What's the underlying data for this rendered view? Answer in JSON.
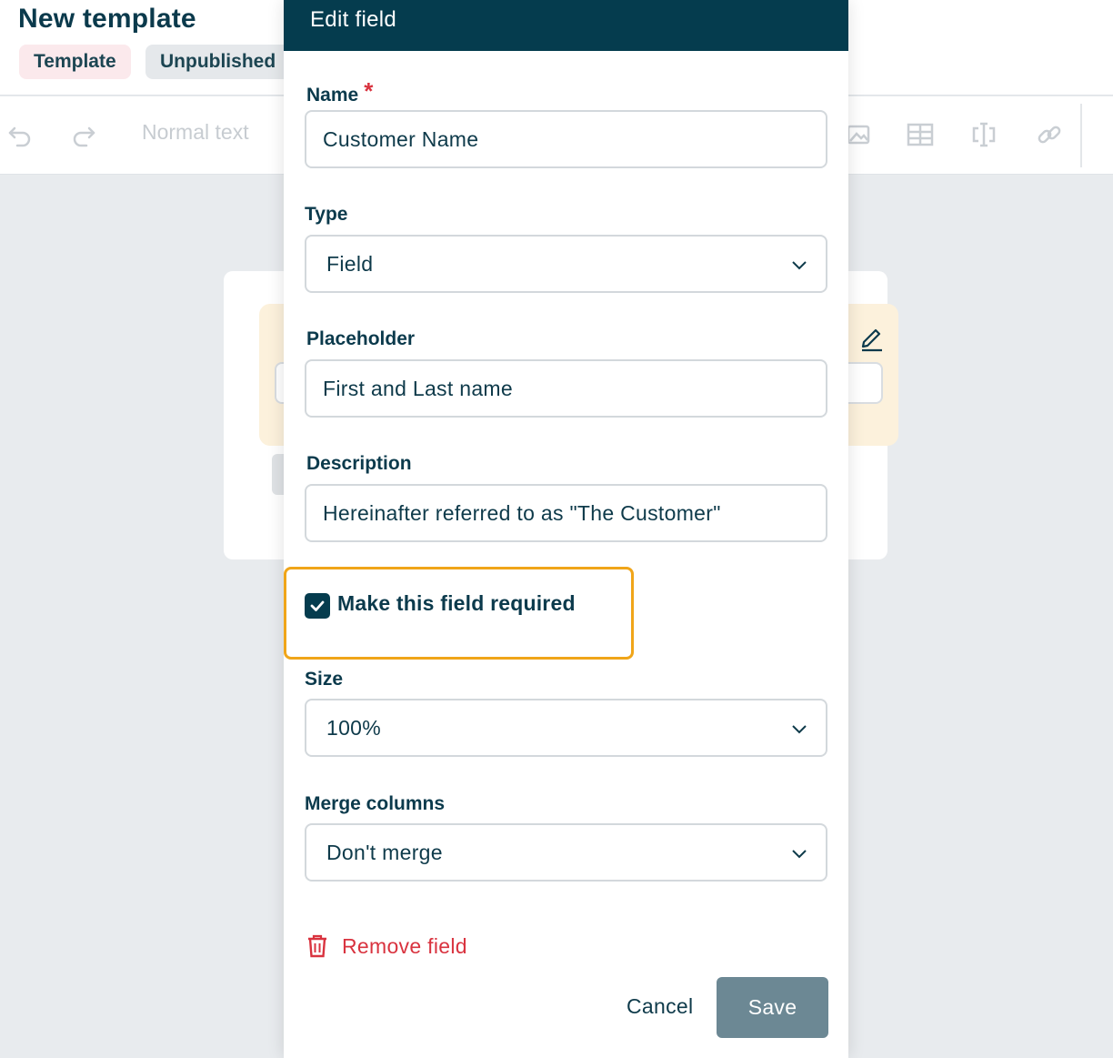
{
  "header": {
    "title": "New template",
    "badges": [
      "Template",
      "Unpublished"
    ]
  },
  "toolbar": {
    "icons": [
      "undo-icon",
      "redo-icon",
      "image-icon",
      "table-icon",
      "field-icon",
      "link-icon"
    ],
    "text_style": "Normal text"
  },
  "modal": {
    "title": "Edit field",
    "name": {
      "label": "Name",
      "required_marker": "*",
      "value": "Customer Name"
    },
    "type": {
      "label": "Type",
      "value": "Field"
    },
    "placeholder": {
      "label": "Placeholder",
      "value": "First and Last name"
    },
    "description": {
      "label": "Description",
      "value": "Hereinafter referred to as \"The Customer\""
    },
    "required": {
      "label": "Make this field required",
      "checked": true
    },
    "size": {
      "label": "Size",
      "value": "100%"
    },
    "merge_columns": {
      "label": "Merge columns",
      "value": "Don't merge"
    },
    "remove_label": "Remove field",
    "cancel_label": "Cancel",
    "save_label": "Save"
  },
  "colors": {
    "header_bg": "#053c4e",
    "danger": "#d9333f",
    "highlight": "#f0a519",
    "save_bg": "#6c8894",
    "field_block_bg": "#fcf1dc"
  }
}
